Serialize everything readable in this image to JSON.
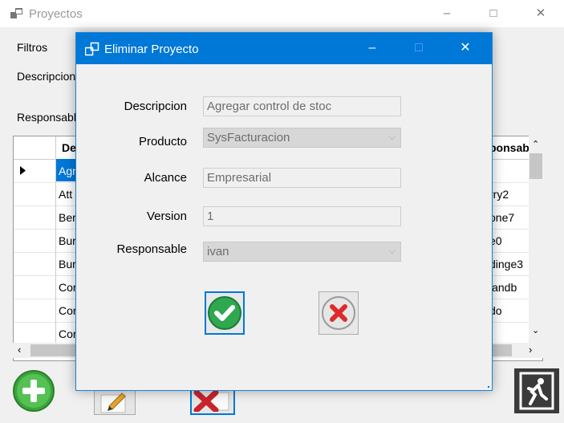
{
  "background": {
    "window_title": "Proyectos",
    "filters_label": "Filtros",
    "description_label": "Descripcion",
    "responsible_label": "Responsable",
    "grid": {
      "col_description_header": "De",
      "col_responsible_header": "ponsable",
      "rows": [
        {
          "description": "Agr",
          "responsible": ""
        },
        {
          "description": "Att",
          "responsible": "rry2"
        },
        {
          "description": "Ber",
          "responsible": "one7"
        },
        {
          "description": "Bur",
          "responsible": "e0"
        },
        {
          "description": "Bur",
          "responsible": "dinge3"
        },
        {
          "description": "Cor",
          "responsible": "landb"
        },
        {
          "description": "Cor",
          "responsible": "do"
        },
        {
          "description": "Cor",
          "responsible": ""
        }
      ]
    }
  },
  "dialog": {
    "title": "Eliminar Proyecto",
    "fields": {
      "descripcion": {
        "label": "Descripcion",
        "value": "Agregar control de stoc"
      },
      "producto": {
        "label": "Producto",
        "value": "SysFacturacion"
      },
      "alcance": {
        "label": "Alcance",
        "value": "Empresarial"
      },
      "version": {
        "label": "Version",
        "value": "1"
      },
      "responsable": {
        "label": "Responsable",
        "value": "ivan"
      }
    }
  },
  "icons": {
    "confirm": "check-circle-icon",
    "cancel": "x-circle-icon",
    "add": "plus-circle-icon",
    "edit": "pencil-icon",
    "delete": "delete-x-icon",
    "exit": "exit-running-man-icon"
  },
  "colors": {
    "dialog_titlebar": "#0078d7",
    "confirm_green": "#2fa84f",
    "cancel_red": "#e02a2a",
    "selected_row": "#0078d7"
  }
}
